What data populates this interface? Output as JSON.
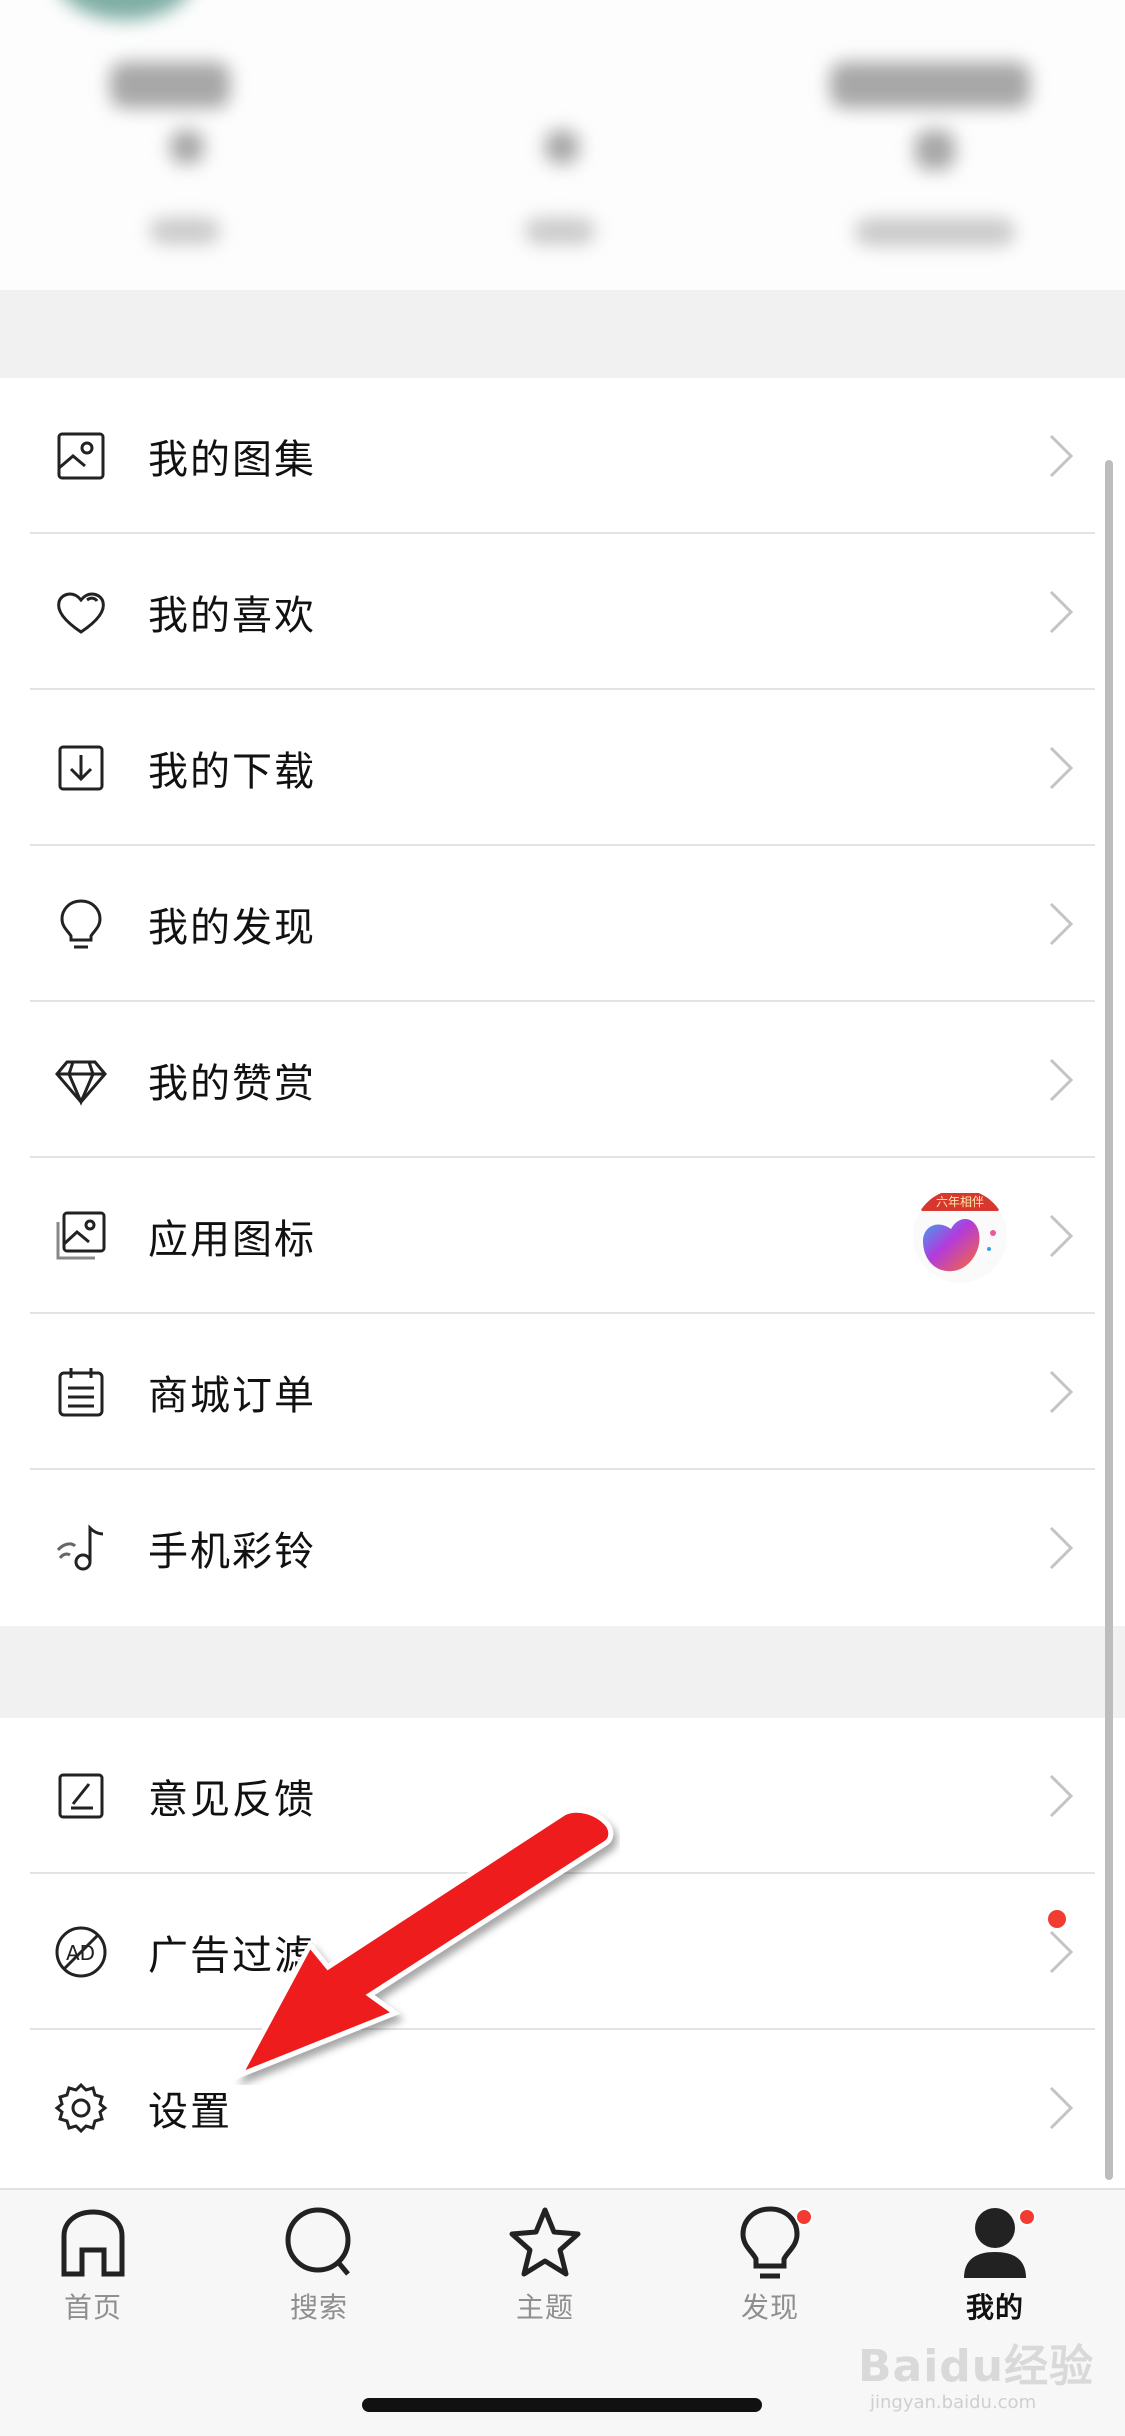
{
  "menu_group_1": [
    {
      "label": "我的图集",
      "icon": "album-icon"
    },
    {
      "label": "我的喜欢",
      "icon": "heart-icon"
    },
    {
      "label": "我的下载",
      "icon": "download-icon"
    },
    {
      "label": "我的发现",
      "icon": "bulb-icon"
    },
    {
      "label": "我的赞赏",
      "icon": "diamond-icon"
    },
    {
      "label": "应用图标",
      "icon": "image-icon",
      "thumb_banner": "六年相伴"
    },
    {
      "label": "商城订单",
      "icon": "order-icon"
    },
    {
      "label": "手机彩铃",
      "icon": "ringtone-icon"
    }
  ],
  "menu_group_2": [
    {
      "label": "意见反馈",
      "icon": "feedback-icon"
    },
    {
      "label": "广告过滤",
      "icon": "ad-block-icon",
      "has_dot": true
    },
    {
      "label": "设置",
      "icon": "gear-icon"
    }
  ],
  "tabbar": {
    "tabs": [
      {
        "label": "首页",
        "icon": "home-icon"
      },
      {
        "label": "搜索",
        "icon": "search-icon"
      },
      {
        "label": "主题",
        "icon": "star-icon"
      },
      {
        "label": "发现",
        "icon": "bulb-icon",
        "badge": true
      },
      {
        "label": "我的",
        "icon": "user-icon",
        "badge": true,
        "active": true
      }
    ]
  },
  "watermark": {
    "brand": "Baidu经验",
    "domain": "jingyan.baidu.com"
  },
  "colors": {
    "badge_red": "#f23c31",
    "arrow_red": "#ee1c1c",
    "gap_gray": "#f1f1f1"
  }
}
